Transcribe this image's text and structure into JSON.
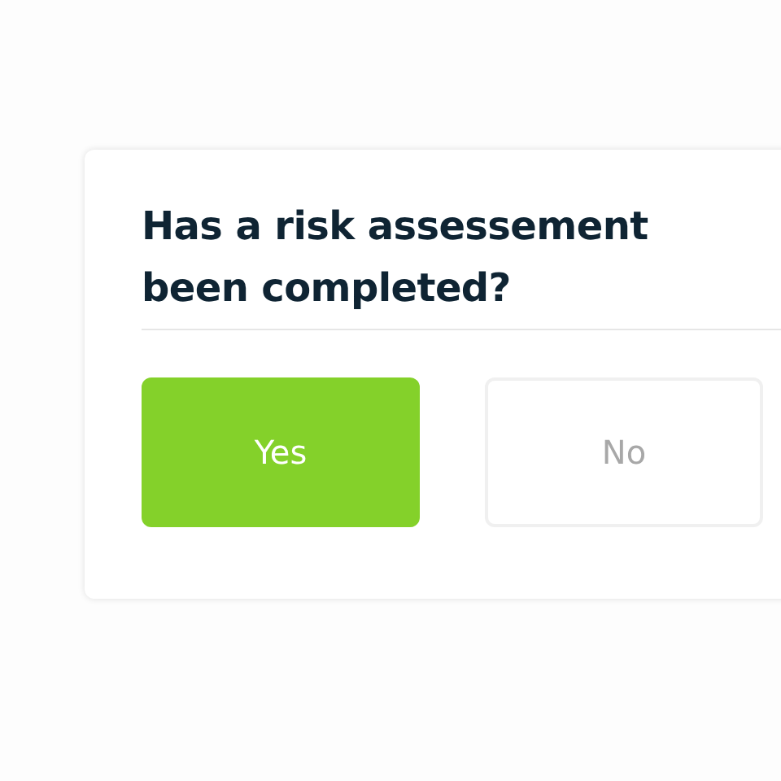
{
  "question": "Has a risk assessement been completed?",
  "options": [
    {
      "label": "Yes",
      "selected": true
    },
    {
      "label": "No",
      "selected": false
    }
  ]
}
